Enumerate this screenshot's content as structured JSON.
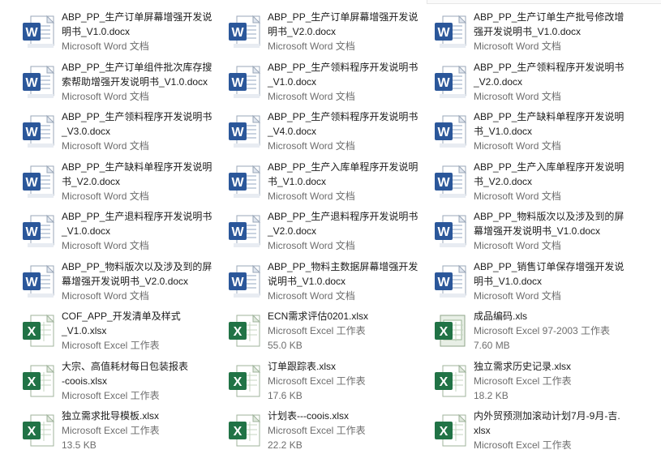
{
  "files": [
    {
      "name_lines": [
        "ABP_PP_生产订单屏幕增强开发说",
        "明书_V1.0.docx"
      ],
      "type": "Microsoft Word 文档",
      "size": "",
      "icon": "word-icon"
    },
    {
      "name_lines": [
        "ABP_PP_生产订单屏幕增强开发说",
        "明书_V2.0.docx"
      ],
      "type": "Microsoft Word 文档",
      "size": "",
      "icon": "word-icon"
    },
    {
      "name_lines": [
        "ABP_PP_生产订单生产批号修改增",
        "强开发说明书_V1.0.docx"
      ],
      "type": "Microsoft Word 文档",
      "size": "",
      "icon": "word-icon"
    },
    {
      "name_lines": [
        "ABP_PP_生产订单组件批次库存搜",
        "索帮助增强开发说明书_V1.0.docx"
      ],
      "type": "Microsoft Word 文档",
      "size": "",
      "icon": "word-icon"
    },
    {
      "name_lines": [
        "ABP_PP_生产领料程序开发说明书",
        "_V1.0.docx"
      ],
      "type": "Microsoft Word 文档",
      "size": "",
      "icon": "word-icon"
    },
    {
      "name_lines": [
        "ABP_PP_生产领料程序开发说明书",
        "_V2.0.docx"
      ],
      "type": "Microsoft Word 文档",
      "size": "",
      "icon": "word-icon"
    },
    {
      "name_lines": [
        "ABP_PP_生产领料程序开发说明书",
        "_V3.0.docx"
      ],
      "type": "Microsoft Word 文档",
      "size": "",
      "icon": "word-icon"
    },
    {
      "name_lines": [
        "ABP_PP_生产领料程序开发说明书",
        "_V4.0.docx"
      ],
      "type": "Microsoft Word 文档",
      "size": "",
      "icon": "word-icon"
    },
    {
      "name_lines": [
        "ABP_PP_生产缺料单程序开发说明",
        "书_V1.0.docx"
      ],
      "type": "Microsoft Word 文档",
      "size": "",
      "icon": "word-icon"
    },
    {
      "name_lines": [
        "ABP_PP_生产缺料单程序开发说明",
        "书_V2.0.docx"
      ],
      "type": "Microsoft Word 文档",
      "size": "",
      "icon": "word-icon"
    },
    {
      "name_lines": [
        "ABP_PP_生产入库单程序开发说明",
        "书_V1.0.docx"
      ],
      "type": "Microsoft Word 文档",
      "size": "",
      "icon": "word-icon"
    },
    {
      "name_lines": [
        "ABP_PP_生产入库单程序开发说明",
        "书_V2.0.docx"
      ],
      "type": "Microsoft Word 文档",
      "size": "",
      "icon": "word-icon"
    },
    {
      "name_lines": [
        "ABP_PP_生产退料程序开发说明书",
        "_V1.0.docx"
      ],
      "type": "Microsoft Word 文档",
      "size": "",
      "icon": "word-icon"
    },
    {
      "name_lines": [
        "ABP_PP_生产退料程序开发说明书",
        "_V2.0.docx"
      ],
      "type": "Microsoft Word 文档",
      "size": "",
      "icon": "word-icon"
    },
    {
      "name_lines": [
        "ABP_PP_物料版次以及涉及到的屏",
        "幕增强开发说明书_V1.0.docx"
      ],
      "type": "Microsoft Word 文档",
      "size": "",
      "icon": "word-icon"
    },
    {
      "name_lines": [
        "ABP_PP_物料版次以及涉及到的屏",
        "幕增强开发说明书_V2.0.docx"
      ],
      "type": "Microsoft Word 文档",
      "size": "",
      "icon": "word-icon"
    },
    {
      "name_lines": [
        "ABP_PP_物料主数据屏幕增强开发",
        "说明书_V1.0.docx"
      ],
      "type": "Microsoft Word 文档",
      "size": "",
      "icon": "word-icon"
    },
    {
      "name_lines": [
        "ABP_PP_销售订单保存增强开发说",
        "明书_V1.0.docx"
      ],
      "type": "Microsoft Word 文档",
      "size": "",
      "icon": "word-icon"
    },
    {
      "name_lines": [
        "COF_APP_开发清单及样式",
        "_V1.0.xlsx"
      ],
      "type": "Microsoft Excel 工作表",
      "size": "",
      "icon": "excel-icon"
    },
    {
      "name_lines": [
        "ECN需求评估0201.xlsx"
      ],
      "type": "Microsoft Excel 工作表",
      "size": "55.0 KB",
      "icon": "excel-icon"
    },
    {
      "name_lines": [
        "成品编码.xls"
      ],
      "type": "Microsoft Excel 97-2003 工作表",
      "size": "7.60 MB",
      "icon": "excel-legacy-icon"
    },
    {
      "name_lines": [
        "大宗、高值耗材每日包装报表",
        "-coois.xlsx"
      ],
      "type": "Microsoft Excel 工作表",
      "size": "",
      "icon": "excel-icon"
    },
    {
      "name_lines": [
        "订单跟踪表.xlsx"
      ],
      "type": "Microsoft Excel 工作表",
      "size": "17.6 KB",
      "icon": "excel-icon"
    },
    {
      "name_lines": [
        "独立需求历史记录.xlsx"
      ],
      "type": "Microsoft Excel 工作表",
      "size": "18.2 KB",
      "icon": "excel-icon"
    },
    {
      "name_lines": [
        "独立需求批导模板.xlsx"
      ],
      "type": "Microsoft Excel 工作表",
      "size": "13.5 KB",
      "icon": "excel-icon"
    },
    {
      "name_lines": [
        "计划表---coois.xlsx"
      ],
      "type": "Microsoft Excel 工作表",
      "size": "22.2 KB",
      "icon": "excel-icon"
    },
    {
      "name_lines": [
        "内外贸预测加滚动计划7月-9月-吉.",
        "xlsx"
      ],
      "type": "Microsoft Excel 工作表",
      "size": "",
      "icon": "excel-icon"
    }
  ],
  "colors": {
    "word_blue": "#2b579a",
    "excel_green": "#217346",
    "type_text": "#6d6d6d",
    "name_text": "#1b1b1b"
  }
}
